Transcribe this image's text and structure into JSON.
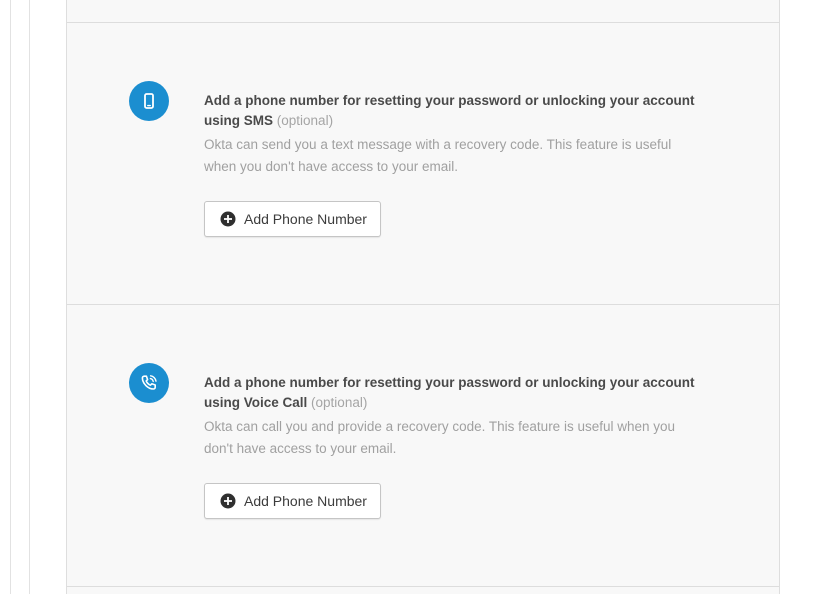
{
  "sections": [
    {
      "icon": "mobile-phone-icon",
      "heading_main": "Add a phone number for resetting your password or unlocking your account using SMS",
      "heading_optional": "(optional)",
      "description": "Okta can send you a text message with a recovery code. This feature is useful when you don't have access to your email.",
      "button_label": "Add Phone Number"
    },
    {
      "icon": "phone-call-icon",
      "heading_main": "Add a phone number for resetting your password or unlocking your account using Voice Call",
      "heading_optional": "(optional)",
      "description": "Okta can call you and provide a recovery code. This feature is useful when you don't have access to your email.",
      "button_label": "Add Phone Number"
    }
  ],
  "colors": {
    "icon_background": "#1b8ed0",
    "panel_background": "#f8f8f8",
    "heading_text": "#4a4a4a",
    "muted_text": "#a0a0a0"
  }
}
